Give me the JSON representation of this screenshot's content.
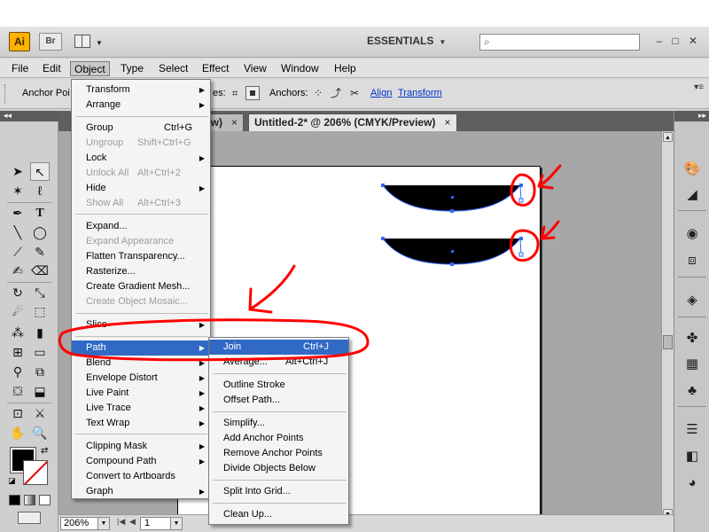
{
  "titlebar": {
    "app_logo": "Ai",
    "bridge_button": "Br",
    "workspace": "ESSENTIALS",
    "search_placeholder": "",
    "minimize": "–",
    "restore": "□",
    "close": "✕"
  },
  "menubar": [
    "File",
    "Edit",
    "Object",
    "Type",
    "Select",
    "Effect",
    "View",
    "Window",
    "Help"
  ],
  "controlbar": {
    "anchor_points_label": "Anchor Poi",
    "handles_label": "es:",
    "anchors_label": "Anchors:",
    "align_link": "Align",
    "transform_link": "Transform"
  },
  "document": {
    "tab1_label": "w)",
    "tab1_close": "×",
    "tab2_label": "Untitled-2* @ 206% (CMYK/Preview)",
    "tab2_close": "×"
  },
  "statusbar": {
    "zoom": "206%",
    "page": "1"
  },
  "object_menu": {
    "items": [
      {
        "label": "Transform",
        "shortcut": "",
        "submenu": true,
        "disabled": false
      },
      {
        "label": "Arrange",
        "shortcut": "",
        "submenu": true,
        "disabled": false
      },
      {
        "label": "Group",
        "shortcut": "Ctrl+G",
        "submenu": false,
        "disabled": false
      },
      {
        "label": "Ungroup",
        "shortcut": "Shift+Ctrl+G",
        "submenu": false,
        "disabled": true
      },
      {
        "label": "Lock",
        "shortcut": "",
        "submenu": true,
        "disabled": false
      },
      {
        "label": "Unlock All",
        "shortcut": "Alt+Ctrl+2",
        "submenu": false,
        "disabled": true
      },
      {
        "label": "Hide",
        "shortcut": "",
        "submenu": true,
        "disabled": false
      },
      {
        "label": "Show All",
        "shortcut": "Alt+Ctrl+3",
        "submenu": false,
        "disabled": true
      },
      {
        "label": "Expand...",
        "shortcut": "",
        "submenu": false,
        "disabled": false
      },
      {
        "label": "Expand Appearance",
        "shortcut": "",
        "submenu": false,
        "disabled": true
      },
      {
        "label": "Flatten Transparency...",
        "shortcut": "",
        "submenu": false,
        "disabled": false
      },
      {
        "label": "Rasterize...",
        "shortcut": "",
        "submenu": false,
        "disabled": false
      },
      {
        "label": "Create Gradient Mesh...",
        "shortcut": "",
        "submenu": false,
        "disabled": false
      },
      {
        "label": "Create Object Mosaic...",
        "shortcut": "",
        "submenu": false,
        "disabled": true
      },
      {
        "label": "Slice",
        "shortcut": "",
        "submenu": true,
        "disabled": false
      },
      {
        "label": "Path",
        "shortcut": "",
        "submenu": true,
        "disabled": false,
        "highlighted": true
      },
      {
        "label": "Blend",
        "shortcut": "",
        "submenu": true,
        "disabled": false
      },
      {
        "label": "Envelope Distort",
        "shortcut": "",
        "submenu": true,
        "disabled": false
      },
      {
        "label": "Live Paint",
        "shortcut": "",
        "submenu": true,
        "disabled": false
      },
      {
        "label": "Live Trace",
        "shortcut": "",
        "submenu": true,
        "disabled": false
      },
      {
        "label": "Text Wrap",
        "shortcut": "",
        "submenu": true,
        "disabled": false
      },
      {
        "label": "Clipping Mask",
        "shortcut": "",
        "submenu": true,
        "disabled": false
      },
      {
        "label": "Compound Path",
        "shortcut": "",
        "submenu": true,
        "disabled": false
      },
      {
        "label": "Convert to Artboards",
        "shortcut": "",
        "submenu": false,
        "disabled": false
      },
      {
        "label": "Graph",
        "shortcut": "",
        "submenu": true,
        "disabled": false
      }
    ]
  },
  "path_submenu": {
    "items": [
      {
        "label": "Join",
        "shortcut": "Ctrl+J",
        "highlighted": true
      },
      {
        "label": "Average...",
        "shortcut": "Alt+Ctrl+J"
      },
      {
        "label": "Outline Stroke",
        "shortcut": ""
      },
      {
        "label": "Offset Path...",
        "shortcut": ""
      },
      {
        "label": "Simplify...",
        "shortcut": ""
      },
      {
        "label": "Add Anchor Points",
        "shortcut": ""
      },
      {
        "label": "Remove Anchor Points",
        "shortcut": ""
      },
      {
        "label": "Divide Objects Below",
        "shortcut": ""
      },
      {
        "label": "Split Into Grid...",
        "shortcut": ""
      },
      {
        "label": "Clean Up...",
        "shortcut": ""
      }
    ]
  },
  "colors": {
    "menu_highlight": "#316ac5",
    "annotation_red": "#ff0000",
    "selection_blue": "#3366ff"
  }
}
